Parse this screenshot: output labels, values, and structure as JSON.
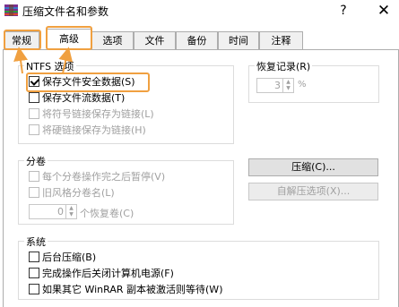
{
  "window": {
    "title": "压缩文件名和参数",
    "help_glyph": "?",
    "close_glyph": "✕"
  },
  "tabs": [
    {
      "label": "常规",
      "selected": false
    },
    {
      "label": "高级",
      "selected": true
    },
    {
      "label": "选项",
      "selected": false
    },
    {
      "label": "文件",
      "selected": false
    },
    {
      "label": "备份",
      "selected": false
    },
    {
      "label": "时间",
      "selected": false
    },
    {
      "label": "注释",
      "selected": false
    }
  ],
  "ntfs": {
    "title": "NTFS 选项",
    "items": [
      {
        "label": "保存文件安全数据(S)",
        "checked": true,
        "enabled": true
      },
      {
        "label": "保存文件流数据(T)",
        "checked": false,
        "enabled": true
      },
      {
        "label": "将符号链接保存为链接(L)",
        "checked": false,
        "enabled": false
      },
      {
        "label": "将硬链接保存为链接(H)",
        "checked": false,
        "enabled": false
      }
    ]
  },
  "recovery": {
    "title": "恢复记录(R)",
    "value": "3",
    "unit": "%"
  },
  "volumes": {
    "title": "分卷",
    "items": [
      {
        "label": "每个分卷操作完之后暂停(V)",
        "checked": false,
        "enabled": false
      },
      {
        "label": "旧风格分卷名(L)",
        "checked": false,
        "enabled": false
      }
    ],
    "recovery_count": "0",
    "recovery_label": "个恢复卷(C)"
  },
  "buttons": {
    "compression": "压缩(C)...",
    "sfx_options": "自解压选项(X)..."
  },
  "system": {
    "title": "系统",
    "items": [
      {
        "label": "后台压缩(B)",
        "checked": false,
        "enabled": true
      },
      {
        "label": "完成操作后关闭计算机电源(F)",
        "checked": false,
        "enabled": true
      },
      {
        "label": "如果其它 WinRAR 副本被激活则等待(W)",
        "checked": false,
        "enabled": true
      }
    ]
  },
  "colors": {
    "highlight": "#f0a040",
    "disabled_text": "#a0a0a0"
  }
}
